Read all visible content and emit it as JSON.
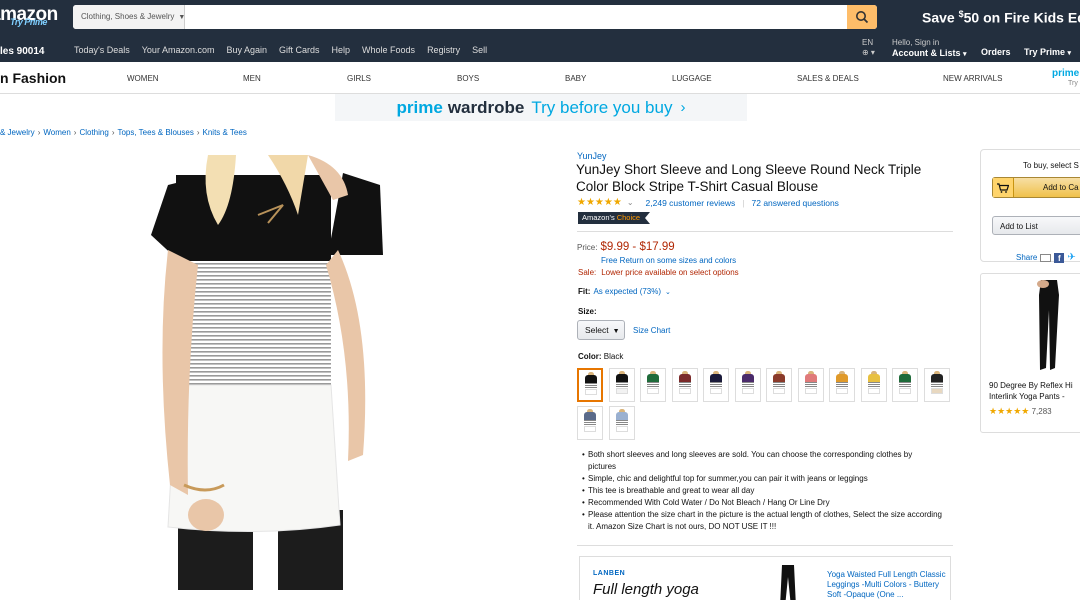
{
  "header": {
    "logo_text": "amazon",
    "try_prime": "Try Prime",
    "search": {
      "department": "Clothing, Shoes & Jewelry",
      "placeholder": ""
    },
    "promo": {
      "pre": "Save ",
      "sup": "$",
      "main": "50 on Fire Kids Ed"
    }
  },
  "subnav": {
    "deliver": "les 90014",
    "links": [
      "Today's Deals",
      "Your Amazon.com",
      "Buy Again",
      "Gift Cards",
      "Help",
      "Whole Foods",
      "Registry",
      "Sell"
    ],
    "lang": "EN",
    "hello": "Hello, Sign in",
    "account": "Account & Lists",
    "orders": "Orders",
    "try_prime": "Try Prime"
  },
  "category_bar": {
    "title": "n Fashion",
    "items": [
      "WOMEN",
      "MEN",
      "GIRLS",
      "BOYS",
      "BABY",
      "LUGGAGE",
      "SALES & DEALS",
      "NEW ARRIVALS"
    ],
    "prime": "prime",
    "prime_sub": "Try"
  },
  "banner": {
    "prime": "prime",
    "wardrobe": "wardrobe",
    "tagline": "Try before you buy",
    "arrow": "›"
  },
  "breadcrumb": [
    "& Jewelry",
    "Women",
    "Clothing",
    "Tops, Tees & Blouses",
    "Knits & Tees"
  ],
  "product": {
    "brand": "YunJey",
    "title": "YunJey Short Sleeve and Long Sleeve Round Neck Triple Color Block Stripe T-Shirt Casual Blouse",
    "stars": "★★★★★",
    "rating": 4.5,
    "reviews": "2,249 customer reviews",
    "answered": "72 answered questions",
    "badge_a": "Amazon's",
    "badge_b": "Choice",
    "price_label": "Price:",
    "price": "$9.99 - $17.99",
    "free_return": "Free Return on some sizes and colors",
    "sale_label": "Sale:",
    "sale_text": "Lower price available on select options",
    "fit_label": "Fit:",
    "fit_value": "As expected (73%)",
    "size_label": "Size:",
    "size_select": "Select",
    "size_chart": "Size Chart",
    "color_label": "Color:",
    "color_value": "Black",
    "swatch_colors": [
      [
        "#111111",
        "#ffffff"
      ],
      [
        "#111111",
        "#f2f2f2"
      ],
      [
        "#1f6b3a",
        "#ffffff"
      ],
      [
        "#7a2a2a",
        "#ffffff"
      ],
      [
        "#1a1a3a",
        "#ffffff"
      ],
      [
        "#4a2a6a",
        "#ffffff"
      ],
      [
        "#8a3a2a",
        "#ffffff"
      ],
      [
        "#e07a7a",
        "#ffffff"
      ],
      [
        "#e09a2a",
        "#ffffff"
      ],
      [
        "#e8c040",
        "#ffffff"
      ],
      [
        "#1f6b3a",
        "#ffffff"
      ],
      [
        "#222222",
        "#e8d8c0"
      ],
      [
        "#5a6a8a",
        "#ffffff"
      ],
      [
        "#9ab0d0",
        "#ffffff"
      ]
    ],
    "bullets": [
      "Both short sleeves and long sleeves are sold. You can choose the corresponding clothes by pictures",
      "Simple, chic and delightful top for summer,you can pair it with jeans or leggings",
      "This tee is breathable and great to wear all day",
      "Recommended With Cold Water / Do Not Bleach / Hang Or Line Dry",
      "Please attention the size chart in the picture is the actual length of clothes, Select the size according it. Amazon Size Chart is not ours, DO NOT USE IT !!!"
    ]
  },
  "ad": {
    "brand": "LANBEN",
    "headline": "Full length yoga",
    "desc": "Yoga Waisted Full Length Classic Leggings -Multi Colors - Buttery Soft -Opaque (One ..."
  },
  "buybox": {
    "to_buy": "To buy, select S",
    "add_to_cart": "Add to Ca",
    "add_to_list": "Add to List",
    "share": "Share"
  },
  "side_ad": {
    "title": "90 Degree By Reflex Hi Interlink Yoga Pants -",
    "stars": "★★★★★",
    "count": "7,283"
  },
  "colors": {
    "nav": "#232f3e",
    "search_button": "#febd69",
    "prime_blue": "#00a8e1",
    "price_red": "#b12704",
    "link": "#0066c0",
    "star": "#f0a800"
  }
}
